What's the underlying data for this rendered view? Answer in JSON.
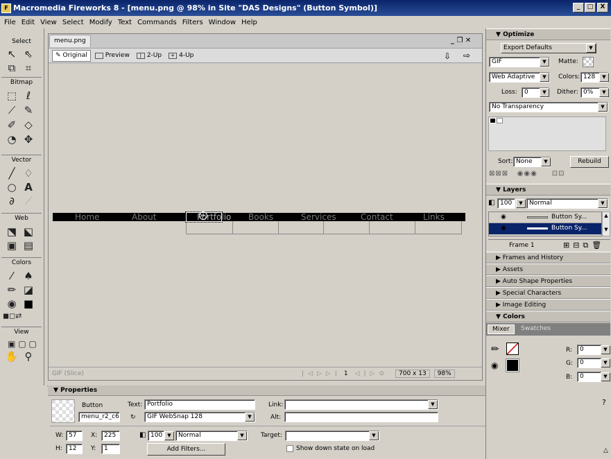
{
  "window": {
    "title": "Macromedia Fireworks 8 - [menu.png @ 98% in Site \"DAS Designs\" (Button Symbol)]",
    "min": "_",
    "restore": "□",
    "close": "X"
  },
  "menubar": [
    "File",
    "Edit",
    "View",
    "Select",
    "Modify",
    "Text",
    "Commands",
    "Filters",
    "Window",
    "Help"
  ],
  "tools": {
    "select_label": "Select",
    "bitmap_label": "Bitmap",
    "vector_label": "Vector",
    "web_label": "Web",
    "colors_label": "Colors",
    "view_label": "View"
  },
  "document": {
    "tab": "menu.png",
    "views": [
      "Original",
      "Preview",
      "2-Up",
      "4-Up"
    ],
    "nav_items": [
      "Home",
      "About",
      "Portfolio",
      "Books",
      "Services",
      "Contact",
      "Links"
    ],
    "status_left": "GIF (Slice)",
    "frame": "1",
    "size": "700 x 13",
    "zoom": "98%"
  },
  "optimize": {
    "title": "Optimize",
    "preset": "Export Defaults",
    "format": "GIF",
    "matte_label": "Matte:",
    "palette": "Web Adaptive",
    "colors_label": "Colors:",
    "colors": "128",
    "loss_label": "Loss:",
    "loss": "0",
    "dither_label": "Dither:",
    "dither": "0%",
    "transparency": "No Transparency",
    "sort_label": "Sort:",
    "sort": "None",
    "rebuild": "Rebuild"
  },
  "layers": {
    "title": "Layers",
    "opacity": "100",
    "blend": "Normal",
    "rows": [
      "Button Sy...",
      "Button Sy..."
    ],
    "frame": "Frame 1"
  },
  "panels": [
    "Frames and History",
    "Assets",
    "Auto Shape Properties",
    "Special Characters",
    "Image Editing"
  ],
  "colors_panel": {
    "title": "Colors",
    "tabs": [
      "Mixer",
      "Swatches"
    ],
    "r_label": "R:",
    "g_label": "G:",
    "b_label": "B:",
    "r": "0",
    "g": "0",
    "b": "0"
  },
  "properties": {
    "title": "Properties",
    "type": "Button",
    "name": "menu_r2_c6",
    "text_label": "Text:",
    "text": "Portfolio",
    "link_label": "Link:",
    "link": "",
    "alt_label": "Alt:",
    "alt": "",
    "export": "GIF WebSnap 128",
    "w_label": "W:",
    "w": "57",
    "x_label": "X:",
    "x": "225",
    "h_label": "H:",
    "h": "12",
    "y_label": "Y:",
    "y": "1",
    "opacity": "100",
    "blend": "Normal",
    "target_label": "Target:",
    "target": "",
    "add_filters": "Add Filters...",
    "show_down": "Show down state on load"
  }
}
